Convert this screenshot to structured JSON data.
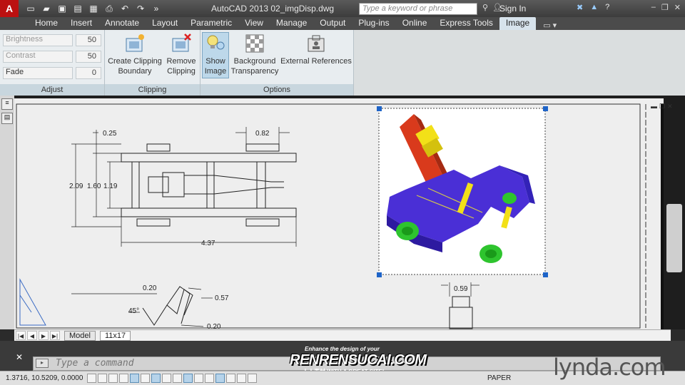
{
  "titlebar": {
    "app_letter": "A",
    "title": "AutoCAD 2013    02_imgDisp.dwg",
    "search_placeholder": "Type a keyword or phrase",
    "sign_in": "Sign In"
  },
  "tabs": [
    "Home",
    "Insert",
    "Annotate",
    "Layout",
    "Parametric",
    "View",
    "Manage",
    "Output",
    "Plug-ins",
    "Online",
    "Express Tools",
    "Image"
  ],
  "active_tab": "Image",
  "ribbon": {
    "adjust": {
      "title": "Adjust",
      "brightness_label": "Brightness",
      "brightness_value": "50",
      "contrast_label": "Contrast",
      "contrast_value": "50",
      "fade_label": "Fade",
      "fade_value": "0"
    },
    "clipping": {
      "title": "Clipping",
      "create_line1": "Create Clipping",
      "create_line2": "Boundary",
      "remove_line1": "Remove",
      "remove_line2": "Clipping"
    },
    "options": {
      "title": "Options",
      "show_line1": "Show",
      "show_line2": "Image",
      "bg_line1": "Background",
      "bg_line2": "Transparency",
      "ext_line1": "External References"
    }
  },
  "drawing": {
    "dims": {
      "d025": "0.25",
      "d082": "0.82",
      "d209": "2.09",
      "d160": "1.60",
      "d119": "1.19",
      "d437": "4.37",
      "d020a": "0.20",
      "d057": "0.57",
      "d45": "45°",
      "d020b": "0.20",
      "d059": "0.59"
    }
  },
  "layout_tabs": [
    "Model",
    "11x17"
  ],
  "command": {
    "placeholder": "Type a command"
  },
  "status": {
    "coords": "1.3716, 10.5209, 0.0000",
    "space": "PAPER"
  },
  "branding": {
    "watermark_top": "Enhance the design of your",
    "watermark_main": "RENRENSUCAI.COM",
    "watermark_sub": "人人素材 WITH A GREAT SITE!",
    "lynda": "lynda.com"
  },
  "colors": {
    "accent": "#c8d6de",
    "active_tab": "#d7e3ec",
    "app_button": "#bb1111"
  }
}
